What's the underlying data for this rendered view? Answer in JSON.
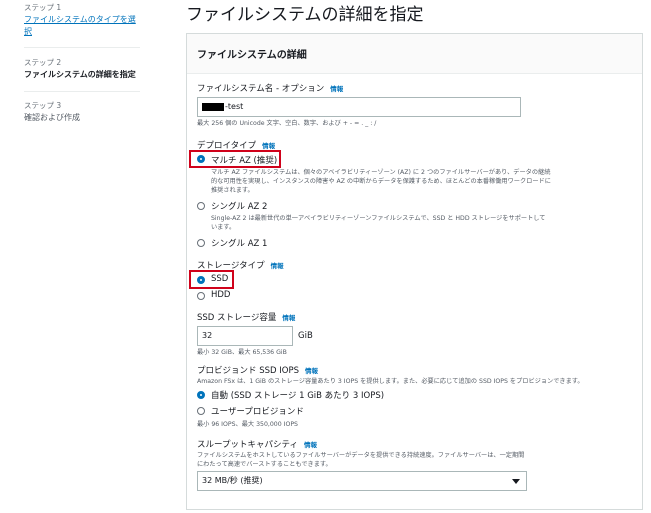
{
  "sidebar": {
    "steps": [
      {
        "label": "ステップ 1",
        "title": "ファイルシステムのタイプを選択"
      },
      {
        "label": "ステップ 2",
        "title": "ファイルシステムの詳細を指定"
      },
      {
        "label": "ステップ 3",
        "title": "確認および作成"
      }
    ]
  },
  "page": {
    "title": "ファイルシステムの詳細を指定"
  },
  "panel": {
    "title": "ファイルシステムの詳細",
    "info_label": "情報",
    "fs_name": {
      "label": "ファイルシステム名 - オプション",
      "value": "-test",
      "hint": "最大 256 個の Unicode 文字、空白、数字、および + - = . _ : /"
    },
    "deploy_type": {
      "label": "デプロイタイプ",
      "multi_az": {
        "label": "マルチ AZ (推奨)",
        "desc": "マルチ AZ ファイルシステムは、個々のアベイラビリティーゾーン (AZ) に 2 つのファイルサーバーがあり、データの継続的な可用性を実現し、インスタンスの障害や AZ の中断からデータを保護するため、ほとんどの本番稼働用ワークロードに推奨されます。"
      },
      "single_az2": {
        "label": "シングル AZ 2",
        "desc": "Single-AZ 2 は最新世代の単一アベイラビリティーゾーンファイルシステムで、SSD と HDD ストレージをサポートしています。"
      },
      "single_az1": {
        "label": "シングル AZ 1"
      }
    },
    "storage_type": {
      "label": "ストレージタイプ",
      "ssd": "SSD",
      "hdd": "HDD"
    },
    "ssd_capacity": {
      "label": "SSD ストレージ容量",
      "value": "32",
      "unit": "GiB",
      "hint": "最小 32 GiB、最大 65,536 GiB"
    },
    "iops": {
      "label": "プロビジョンド SSD IOPS",
      "desc": "Amazon FSx は、1 GiB のストレージ容量あたり 3 IOPS を提供します。また、必要に応じて追加の SSD IOPS をプロビジョンできます。",
      "auto": "自動 (SSD ストレージ 1 GiB あたり 3 IOPS)",
      "user": "ユーザープロビジョンド",
      "hint": "最小 96 IOPS、最大 350,000 IOPS"
    },
    "throughput": {
      "label": "スループットキャパシティ",
      "desc": "ファイルシステムをホストしているファイルサーバーがデータを提供できる持続速度。ファイルサーバーは、一定期間にわたって高速でバーストすることもできます。",
      "value": "32 MB/秒 (推奨)"
    }
  },
  "colors": {
    "accent": "#0073bb",
    "highlight": "#d0021b"
  }
}
